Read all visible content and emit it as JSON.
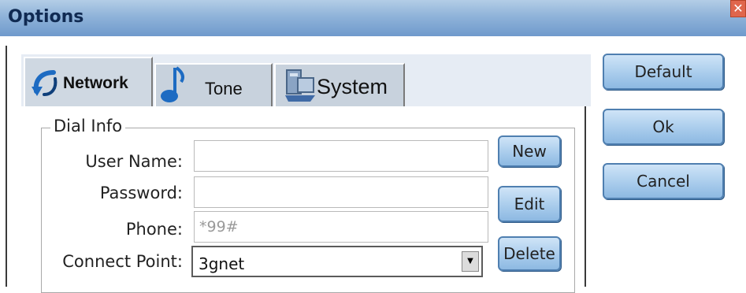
{
  "window": {
    "title": "Options",
    "close_glyph": "✕"
  },
  "tabs": [
    {
      "label": "Network",
      "icon": "network-arrow-icon",
      "active": true
    },
    {
      "label": "Tone",
      "icon": "music-note-icon",
      "active": false
    },
    {
      "label": "System",
      "icon": "computer-system-icon",
      "active": false
    }
  ],
  "dial_info": {
    "group_label": "Dial Info",
    "user_name": {
      "label": "User Name:",
      "value": ""
    },
    "password": {
      "label": "Password:",
      "value": ""
    },
    "phone": {
      "label": "Phone:",
      "value": "*99#"
    },
    "connect_point": {
      "label": "Connect Point:",
      "value": "3gnet",
      "arrow_glyph": "▼"
    }
  },
  "side_buttons": {
    "new": "New",
    "edit": "Edit",
    "delete": "Delete"
  },
  "dialog_buttons": {
    "default": "Default",
    "ok": "Ok",
    "cancel": "Cancel"
  },
  "colors": {
    "titlebar": "#8fb3d9",
    "button": "#a9ccec",
    "close": "#e0664c"
  }
}
